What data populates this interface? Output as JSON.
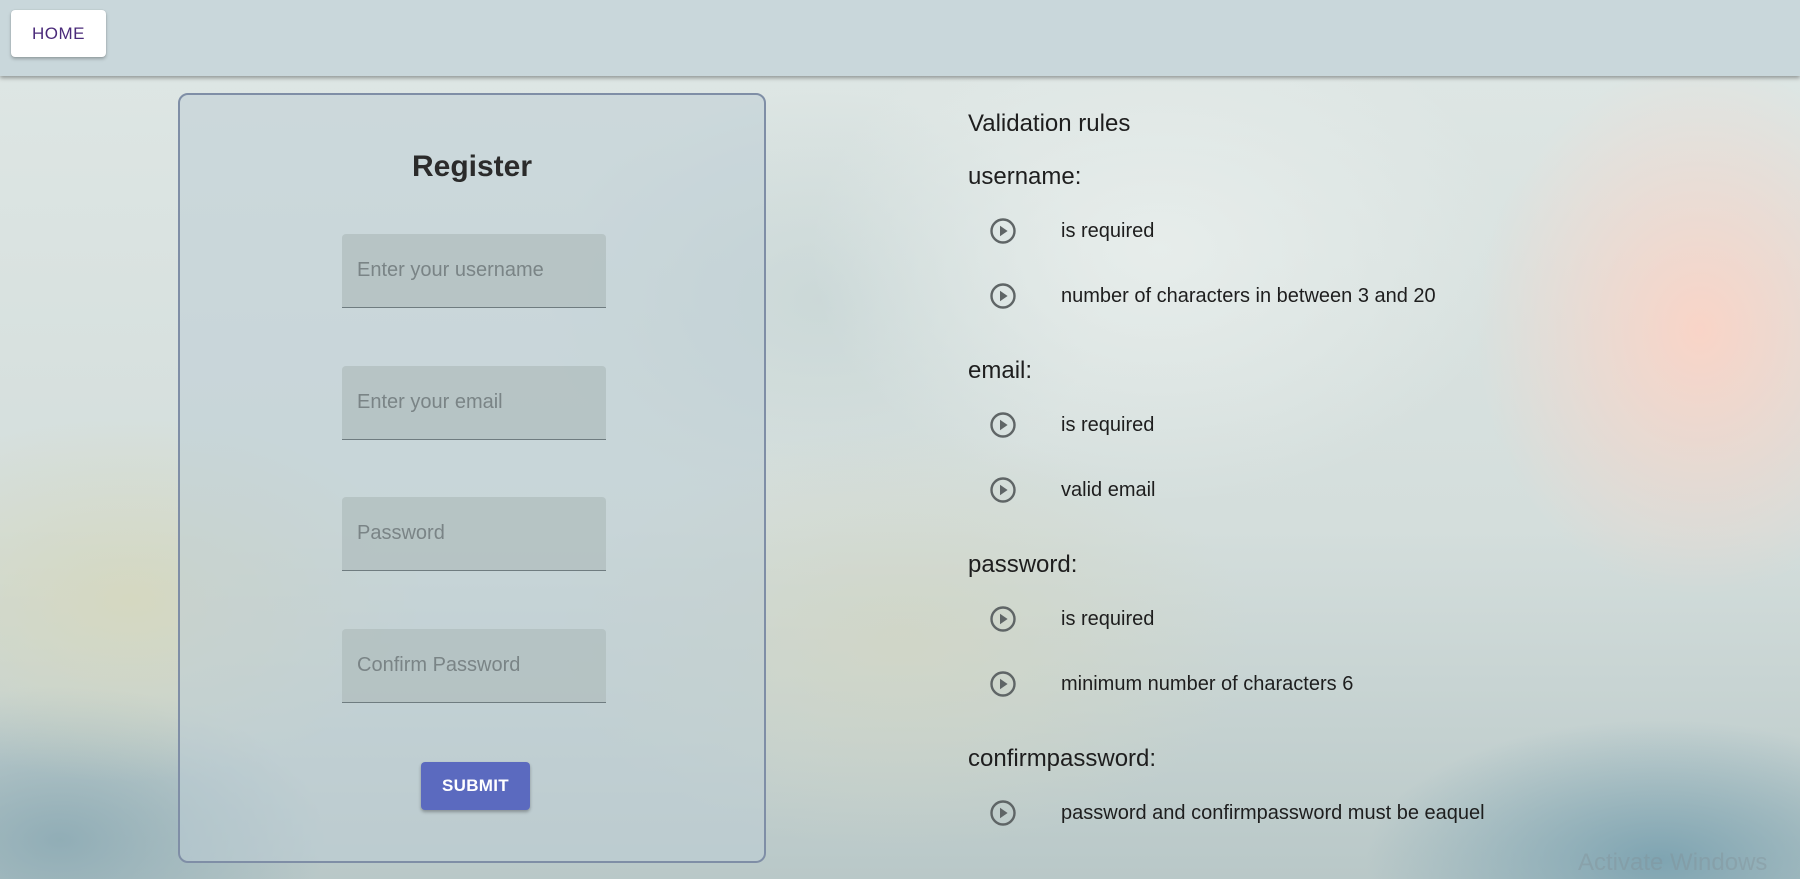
{
  "topbar": {
    "home_label": "HOME"
  },
  "register": {
    "title": "Register",
    "username_placeholder": "Enter your username",
    "email_placeholder": "Enter your email",
    "password_placeholder": "Password",
    "confirm_placeholder": "Confirm Password",
    "submit_label": "SUBMIT"
  },
  "validation": {
    "title": "Validation rules",
    "groups": [
      {
        "label": "username:",
        "rules": [
          "is required",
          "number of characters in between 3 and 20"
        ]
      },
      {
        "label": "email:",
        "rules": [
          "is required",
          "valid email"
        ]
      },
      {
        "label": "password:",
        "rules": [
          "is required",
          "minimum number of characters 6"
        ]
      },
      {
        "label": "confirmpassword:",
        "rules": [
          "password and confirmpassword must be eaquel"
        ]
      }
    ],
    "rule_icon": "play-circle-outline-icon"
  },
  "watermark": "Activate Windows",
  "colors": {
    "topbar": "#c9d7db",
    "home_text": "#4a2a7a",
    "submit": "#5b6abf",
    "card_border": "#7f8ea6"
  }
}
